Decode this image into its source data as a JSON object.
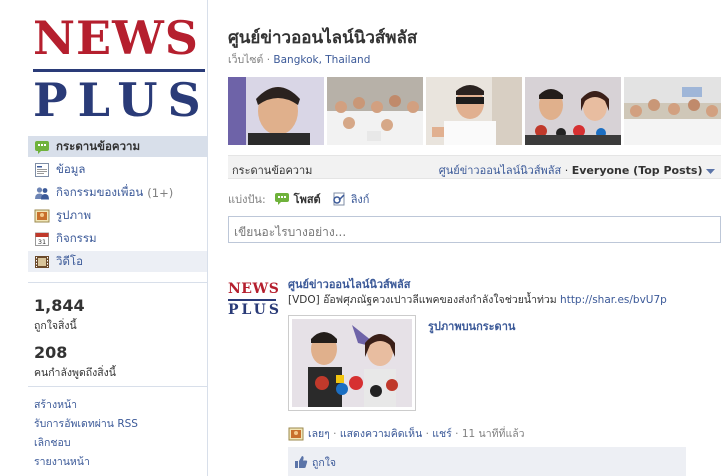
{
  "logo": {
    "line1": "NEWS",
    "line2": "PLUS"
  },
  "nav": [
    {
      "label": "กระดานข้อความ",
      "icon": "wall-icon",
      "active": true
    },
    {
      "label": "ข้อมูล",
      "icon": "info-icon"
    },
    {
      "label": "กิจกรรมของเพื่อน",
      "count": "(1+)",
      "icon": "friends-icon"
    },
    {
      "label": "รูปภาพ",
      "icon": "photos-icon"
    },
    {
      "label": "กิจกรรม",
      "icon": "events-icon"
    },
    {
      "label": "วิดีโอ",
      "icon": "video-icon",
      "hover": true
    }
  ],
  "stats": [
    {
      "num": "1,844",
      "label": "ถูกใจสิ่งนี้"
    },
    {
      "num": "208",
      "label": "คนกำลังพูดถึงสิ่งนี้"
    }
  ],
  "sidebar_links": [
    "สร้างหน้า",
    "รับการอัพเดทผ่าน RSS",
    "เลิกชอบ",
    "รายงานหน้า"
  ],
  "page": {
    "title": "ศูนย์ข่าวออนไลน์นิวส์พลัส",
    "category": "เว็บไซต์",
    "location": "Bangkok, Thailand"
  },
  "wall_bar": {
    "label": "กระดานข้อความ",
    "page_link": "ศูนย์ข่าวออนไลน์นิวส์พลัส",
    "dot": "·",
    "filter": "Everyone (Top Posts)"
  },
  "share": {
    "label": "แบ่งปัน:",
    "options": [
      {
        "label": "โพสต์",
        "selected": true
      },
      {
        "label": "ลิงก์"
      }
    ]
  },
  "composer": {
    "placeholder": "เขียนอะไรบางอย่าง..."
  },
  "story": {
    "author": "ศูนย์ข่าวออนไลน์นิวส์พลัส",
    "message": "[VDO] อ๊อฟศุภณัฐควงเปาวลีแพคของส่งกำลังใจช่วยน้ำท่วม",
    "url": "http://shar.es/bvU7p",
    "attachment_title": "รูปภาพบนกระดาน",
    "meta": {
      "like": "เลยๆ",
      "comment": "แสดงความคิดเห็น",
      "share": "แชร์",
      "time": "11 นาทีที่แล้ว"
    },
    "likes_label": "ถูกใจ"
  },
  "colors": {
    "brand_red": "#b51f2e",
    "brand_blue": "#2a3b78",
    "link": "#3b5998",
    "nav_active": "#d8dfea"
  }
}
